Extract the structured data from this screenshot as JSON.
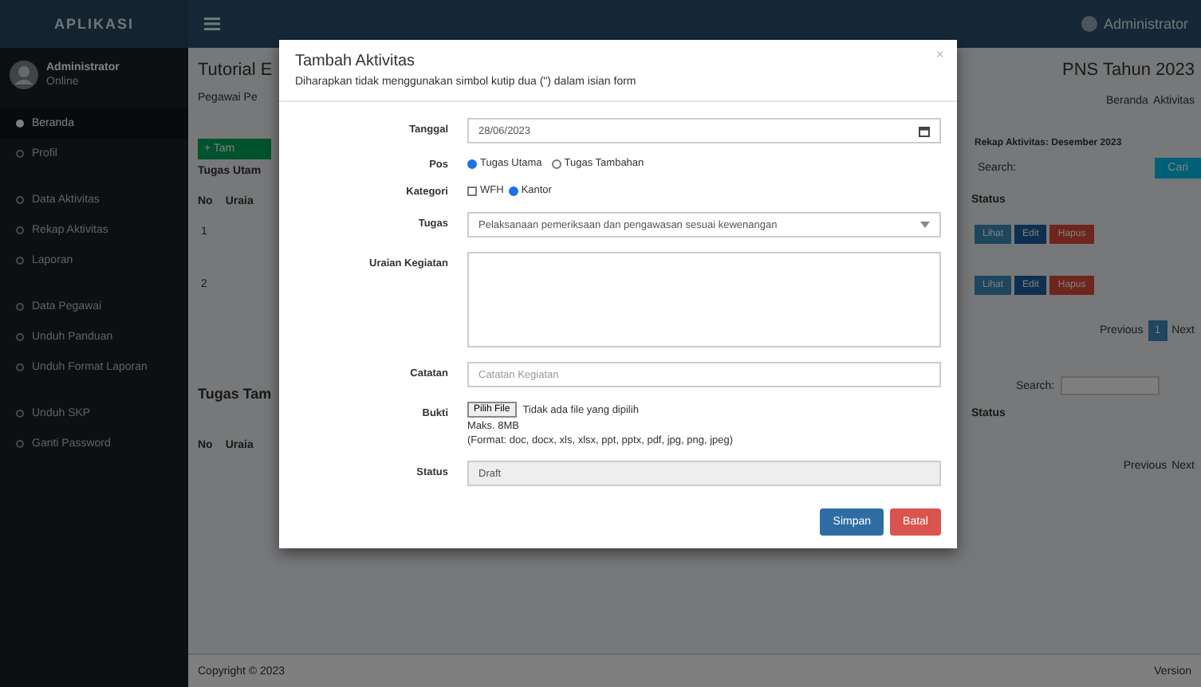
{
  "topbar": {
    "brand": "APLIKASI",
    "user": "Administrator"
  },
  "sidebar": {
    "user": {
      "name": "Administrator",
      "status": "Online"
    },
    "items": [
      {
        "label": "Beranda",
        "selected": true
      },
      {
        "label": "Profil",
        "selected": false
      },
      {
        "label": "Data Aktivitas",
        "selected": false
      },
      {
        "label": "Rekap Aktivitas",
        "selected": false
      },
      {
        "label": "Laporan",
        "selected": false
      },
      {
        "label": "Data Pegawai",
        "selected": false
      },
      {
        "label": "Unduh Panduan",
        "selected": false
      },
      {
        "label": "Unduh Format Laporan",
        "selected": false
      },
      {
        "label": "Unduh SKP",
        "selected": false
      },
      {
        "label": "Ganti Password",
        "selected": false
      }
    ]
  },
  "content": {
    "left": {
      "title": "Tutorial E",
      "subtitle": "Pegawai Pe",
      "add_button": "+ Tam",
      "section_1": "Tugas Utam",
      "header_no": "No",
      "header_2": "Uraia",
      "rows": [
        "1",
        "2"
      ],
      "section_2": "Tugas Tam",
      "header_no_2": "No",
      "header_2b": "Uraia"
    },
    "right": {
      "title": "PNS Tahun 2023",
      "breadcrumb": [
        "Beranda",
        "Aktivitas"
      ],
      "info": "Rekap Aktivitas: Desember 2023",
      "search_label": "Search:",
      "search_button": "Cari",
      "header": "Status",
      "row_buttons": [
        [
          "Lihat",
          "Edit",
          "Hapus"
        ],
        [
          "Lihat",
          "Edit",
          "Hapus"
        ]
      ],
      "pagination": [
        "Previous",
        "1",
        "Next"
      ],
      "search_label_2": "Search:",
      "header_2": "Status",
      "pagination_2": [
        "Previous",
        "Next"
      ]
    },
    "footer": "Copyright © 2023",
    "footer_right": "Version"
  },
  "modal": {
    "title": "Tambah Aktivitas",
    "subtitle": "Diharapkan tidak menggunakan simbol kutip dua (\") dalam isian form",
    "close": "×",
    "fields": [
      {
        "kind": "date",
        "label": "Tanggal",
        "value": "28/06/2023"
      },
      {
        "kind": "radio",
        "label": "Pos",
        "options": [
          {
            "label": "Tugas Utama",
            "selected": true
          },
          {
            "label": "Tugas Tambahan",
            "selected": false
          }
        ]
      },
      {
        "kind": "choice",
        "label": "Kategori",
        "options": [
          {
            "kind": "checkbox",
            "label": "WFH",
            "checked": false
          },
          {
            "kind": "radio",
            "label": "Kantor",
            "checked": true
          }
        ]
      },
      {
        "kind": "select",
        "label": "Tugas",
        "value": "Pelaksanaan pemeriksaan dan pengawasan sesuai kewenangan"
      },
      {
        "kind": "textarea",
        "label": "Uraian Kegiatan"
      },
      {
        "kind": "text",
        "label": "Catatan",
        "placeholder": "Catatan Kegiatan"
      },
      {
        "kind": "file",
        "label": "Bukti",
        "button": "Pilih File",
        "value": "Tidak ada file yang dipilih",
        "help": [
          "Maks. 8MB",
          "(Format: doc, docx, xls, xlsx, ppt, pptx, pdf, jpg, png, jpeg)"
        ]
      },
      {
        "kind": "readonly",
        "label": "Status",
        "value": "Draft"
      }
    ],
    "buttons": [
      {
        "kind": "primary",
        "label": "Simpan"
      },
      {
        "kind": "danger",
        "label": "Batal"
      }
    ]
  }
}
